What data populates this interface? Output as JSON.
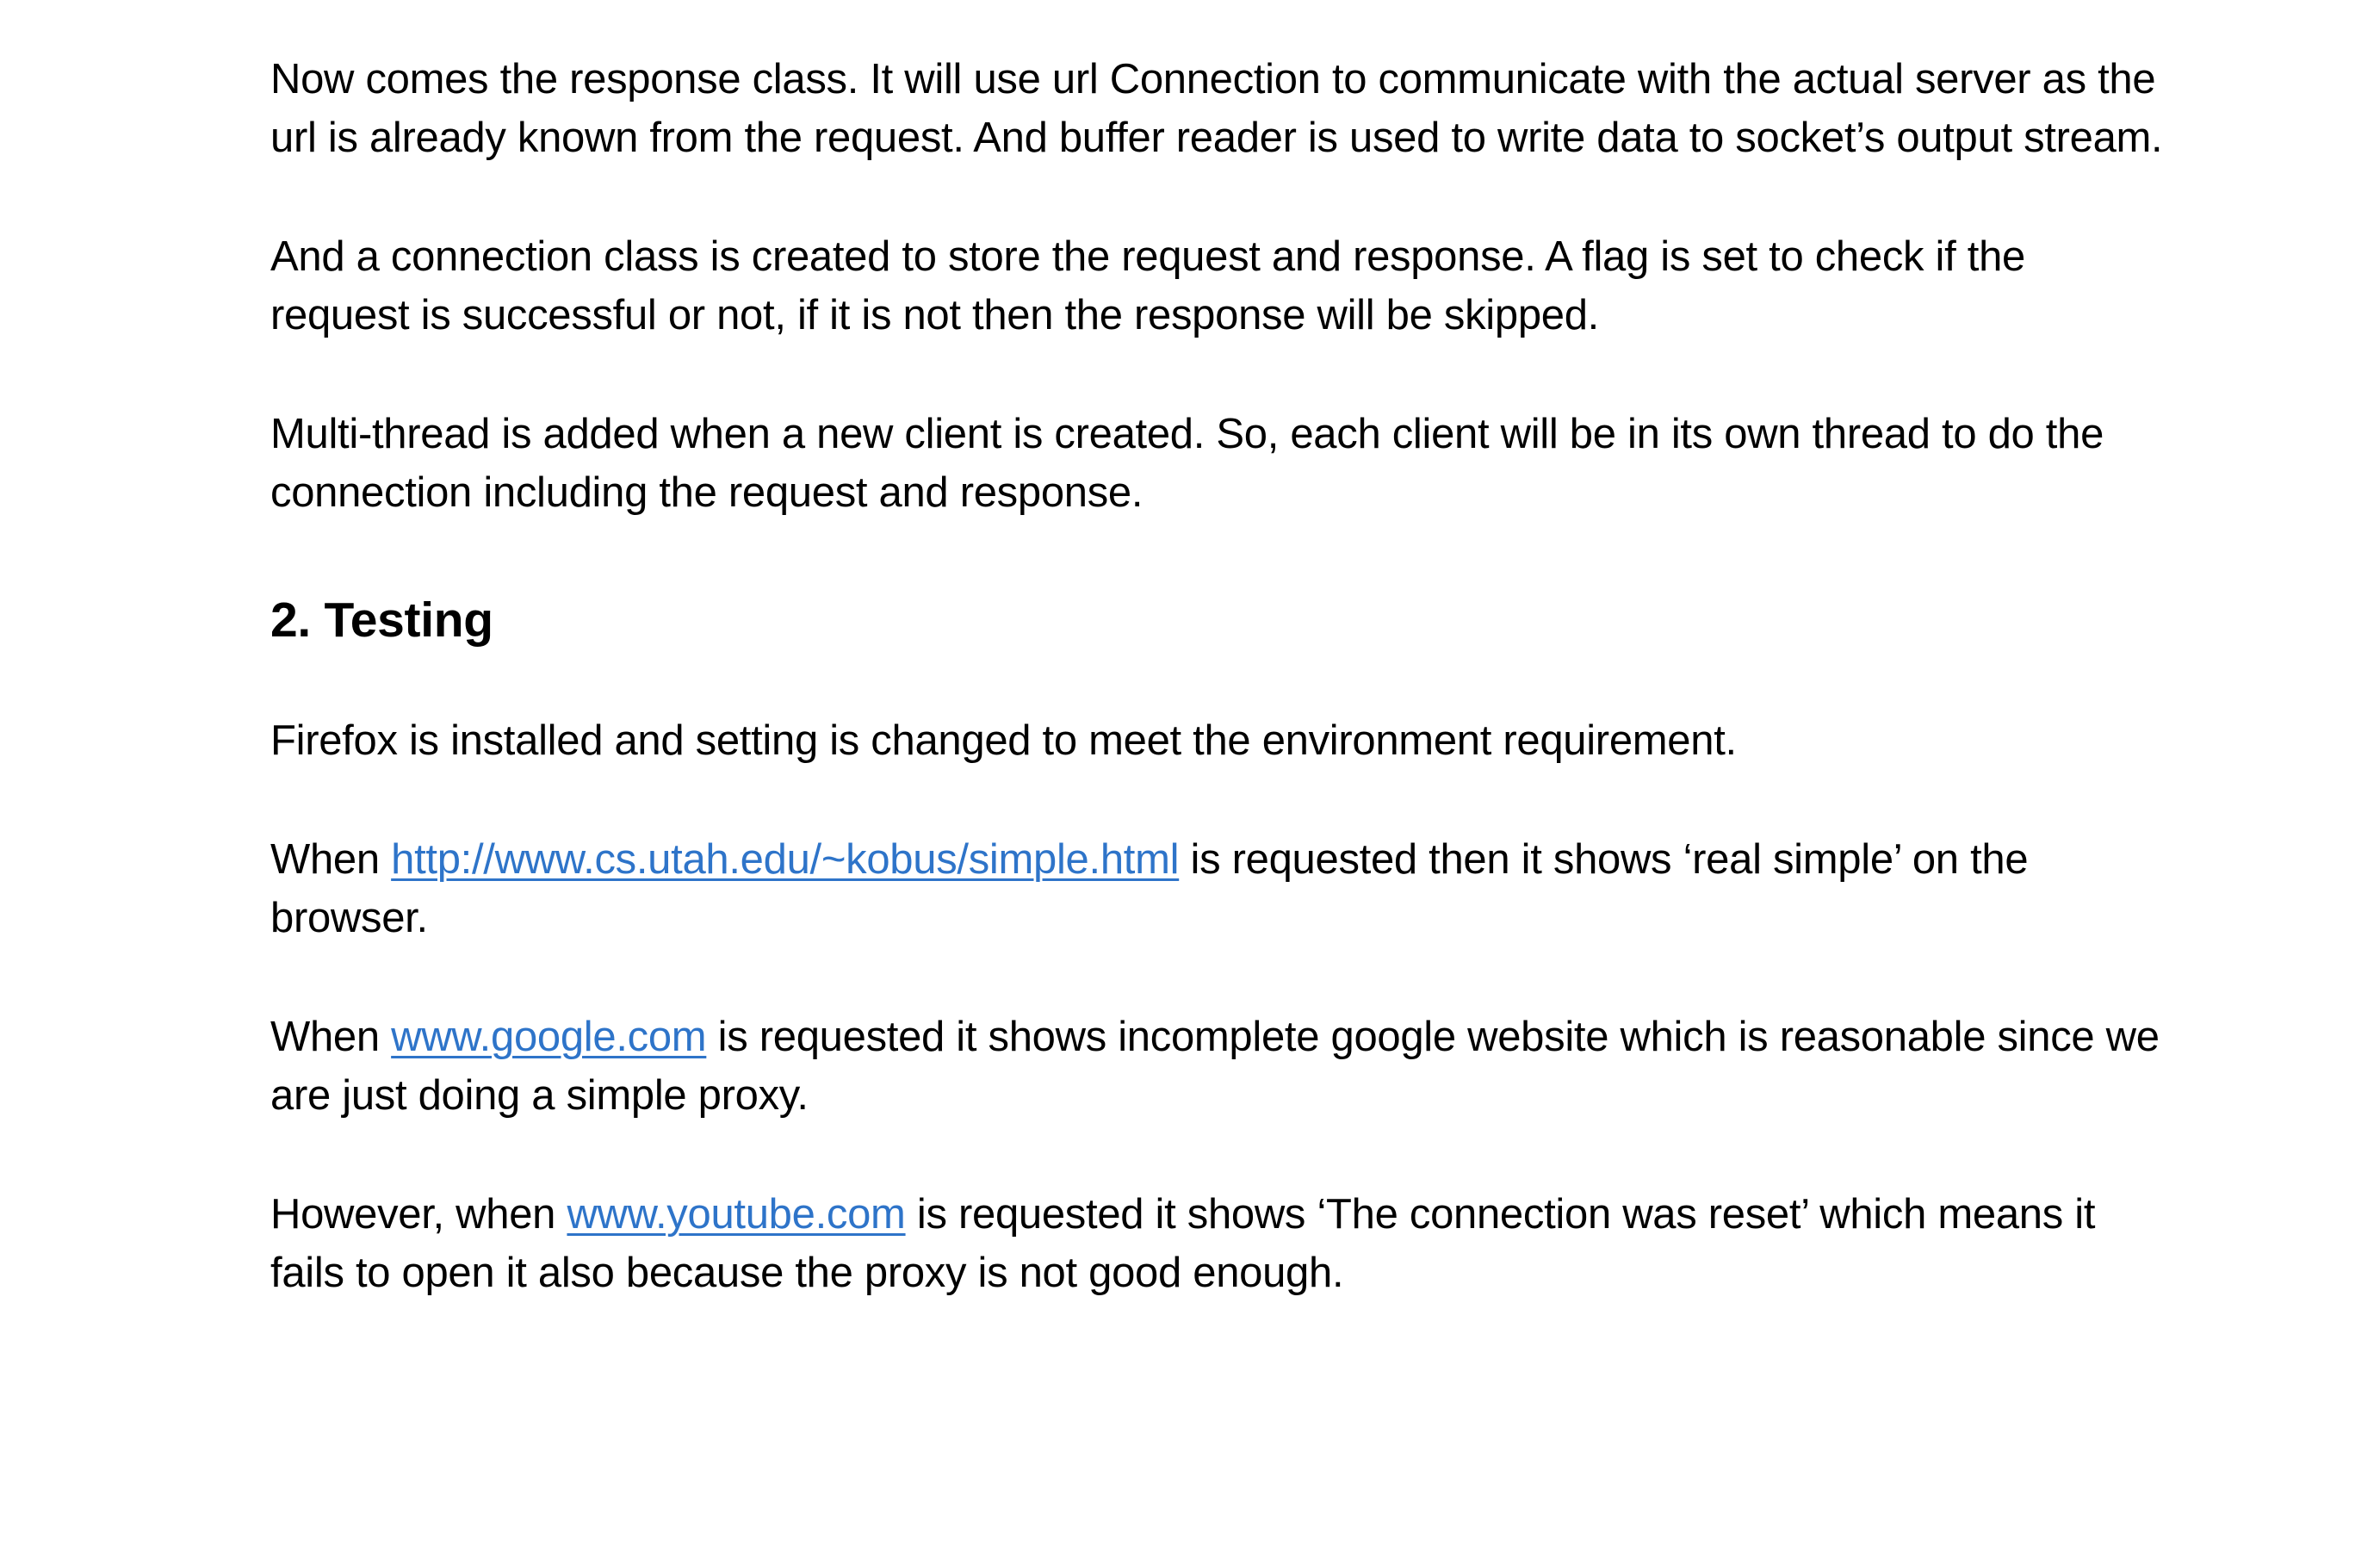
{
  "paragraphs": {
    "response_class": "Now comes the response class. It will use url Connection to communicate with the actual server as the url is already known from the request. And buffer reader is used to write data to socket’s output stream.",
    "connection_class": "And a connection class is created to store the request and response. A flag is set to check if the request is successful or not, if it is not then the response will be skipped.",
    "multi_thread": "Multi-thread is added when a new client is created. So, each client will be in its own thread to do the connection including the request and response."
  },
  "section_heading": "2. Testing",
  "testing": {
    "firefox": "Firefox is installed and setting is changed to meet the environment requirement.",
    "simple": {
      "before": "When ",
      "link": "http://www.cs.utah.edu/~kobus/simple.html",
      "after": " is requested then it shows ‘real simple’ on the browser."
    },
    "google": {
      "before": "When ",
      "link": "www.google.com",
      "after": " is requested it shows incomplete google website which is reasonable since we are just doing a simple proxy."
    },
    "youtube": {
      "before": "However, when ",
      "link": "www.youtube.com",
      "after": " is requested it shows ‘The connection was reset’ which means it fails to open it also because the proxy is not good enough."
    }
  },
  "colors": {
    "text": "#000000",
    "link": "#2e74c9",
    "background": "#ffffff"
  }
}
